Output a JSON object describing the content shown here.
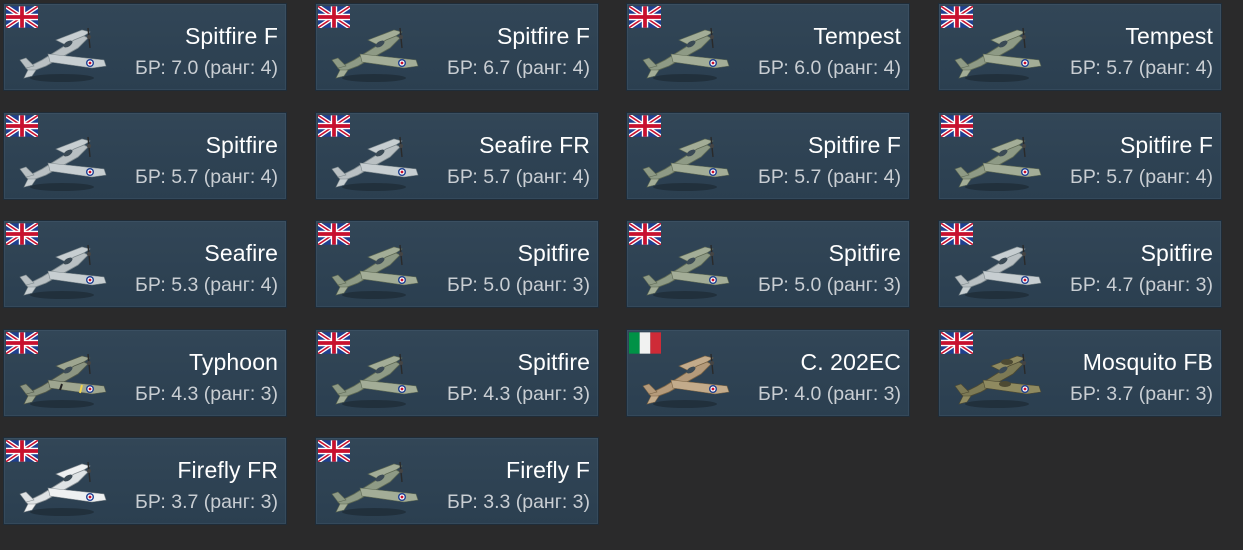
{
  "vehicles": [
    {
      "name": "Spitfire F",
      "br": "БР: 7.0 (ранг: 4)",
      "flag": "uk-flag-icon",
      "plane": "spitfire-icon",
      "livery": "grey"
    },
    {
      "name": "Spitfire F",
      "br": "БР: 6.7 (ранг: 4)",
      "flag": "uk-flag-icon",
      "plane": "spitfire-icon",
      "livery": "camo"
    },
    {
      "name": "Tempest",
      "br": "БР: 6.0 (ранг: 4)",
      "flag": "uk-flag-icon",
      "plane": "tempest-icon",
      "livery": "camo"
    },
    {
      "name": "Tempest",
      "br": "БР: 5.7 (ранг: 4)",
      "flag": "uk-flag-icon",
      "plane": "tempest-icon",
      "livery": "camo"
    },
    {
      "name": "Spitfire",
      "br": "БР: 5.7 (ранг: 4)",
      "flag": "uk-flag-icon",
      "plane": "spitfire-icon",
      "livery": "grey"
    },
    {
      "name": "Seafire FR",
      "br": "БР: 5.7 (ранг: 4)",
      "flag": "uk-flag-icon",
      "plane": "seafire-icon",
      "livery": "grey"
    },
    {
      "name": "Spitfire F",
      "br": "БР: 5.7 (ранг: 4)",
      "flag": "uk-flag-icon",
      "plane": "spitfire-icon",
      "livery": "camo"
    },
    {
      "name": "Spitfire F",
      "br": "БР: 5.7 (ранг: 4)",
      "flag": "uk-flag-icon",
      "plane": "spitfire-icon",
      "livery": "camo"
    },
    {
      "name": "Seafire",
      "br": "БР: 5.3 (ранг: 4)",
      "flag": "uk-flag-icon",
      "plane": "seafire-icon",
      "livery": "grey"
    },
    {
      "name": "Spitfire",
      "br": "БР: 5.0 (ранг: 3)",
      "flag": "uk-flag-icon",
      "plane": "spitfire-icon",
      "livery": "camo"
    },
    {
      "name": "Spitfire",
      "br": "БР: 5.0 (ранг: 3)",
      "flag": "uk-flag-icon",
      "plane": "spitfire-icon",
      "livery": "camo"
    },
    {
      "name": "Spitfire",
      "br": "БР: 4.7 (ранг: 3)",
      "flag": "uk-flag-icon",
      "plane": "spitfire-icon",
      "livery": "grey"
    },
    {
      "name": "Typhoon",
      "br": "БР: 4.3 (ранг: 3)",
      "flag": "uk-flag-icon",
      "plane": "typhoon-icon",
      "livery": "stripes"
    },
    {
      "name": "Spitfire",
      "br": "БР: 4.3 (ранг: 3)",
      "flag": "uk-flag-icon",
      "plane": "spitfire-icon",
      "livery": "camo"
    },
    {
      "name": "C. 202EC",
      "br": "БР: 4.0 (ранг: 3)",
      "flag": "italy-flag-icon",
      "plane": "c202-icon",
      "livery": "desert"
    },
    {
      "name": "Mosquito FB",
      "br": "БР: 3.7 (ранг: 3)",
      "flag": "uk-flag-icon",
      "plane": "mosquito-icon",
      "livery": "olive"
    },
    {
      "name": "Firefly FR",
      "br": "БР: 3.7 (ранг: 3)",
      "flag": "uk-flag-icon",
      "plane": "firefly-icon",
      "livery": "white"
    },
    {
      "name": "Firefly F",
      "br": "БР: 3.3 (ранг: 3)",
      "flag": "uk-flag-icon",
      "plane": "firefly-icon",
      "livery": "camo"
    }
  ],
  "colors": {
    "page_background": "#2a2a2b",
    "card_background": "#2f4354",
    "name_text": "#ffffff",
    "br_text": "#c9ced3"
  }
}
